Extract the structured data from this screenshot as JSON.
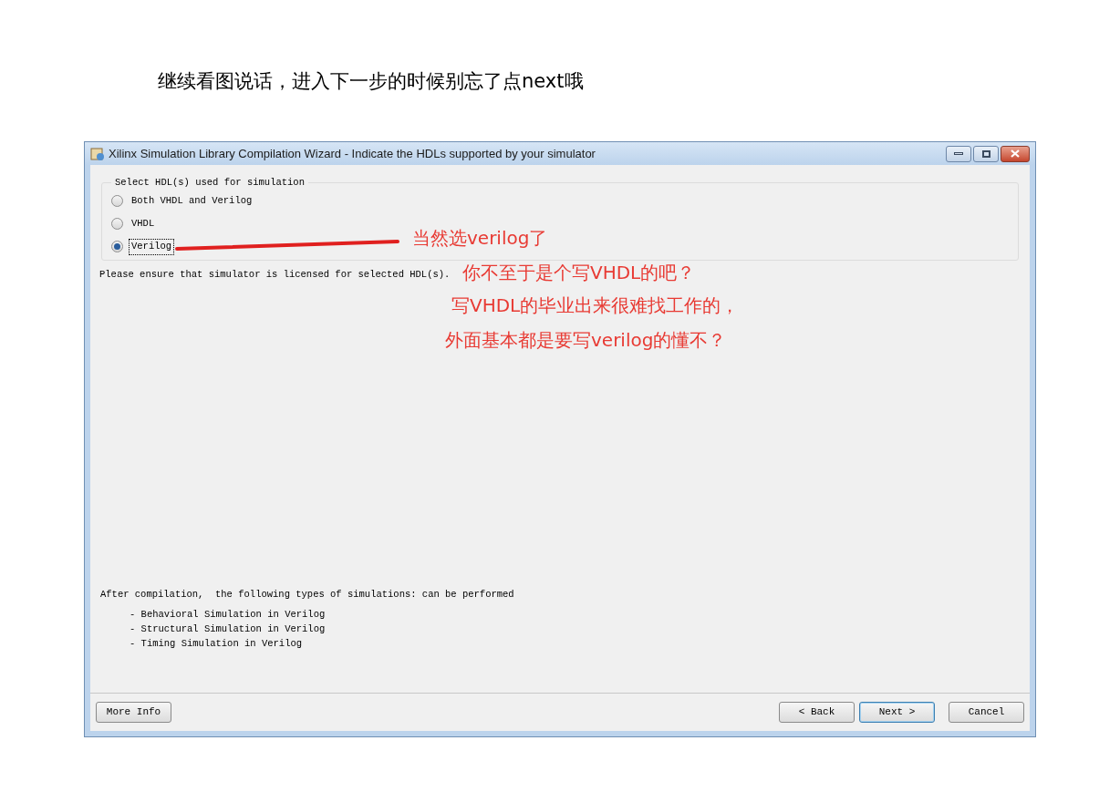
{
  "page_caption": "继续看图说话，进入下一步的时候别忘了点next哦",
  "window": {
    "title": "Xilinx Simulation Library Compilation Wizard - Indicate the HDLs supported by your simulator"
  },
  "hdl_group": {
    "legend": "Select HDL(s) used for simulation",
    "options": [
      {
        "label": "Both VHDL and Verilog",
        "selected": false
      },
      {
        "label": "VHDL",
        "selected": false
      },
      {
        "label": "Verilog",
        "selected": true
      }
    ]
  },
  "license_note": "Please ensure that simulator is licensed for selected HDL(s).",
  "summary": {
    "intro": "After compilation,  the following types of simulations: can be performed",
    "items": [
      "- Behavioral Simulation in Verilog",
      "- Structural Simulation in Verilog",
      "- Timing Simulation in Verilog"
    ]
  },
  "buttons": {
    "more_info": "More Info",
    "back": "< Back",
    "next": "Next >",
    "cancel": "Cancel"
  },
  "annotations": [
    "当然选verilog了",
    "你不至于是个写VHDL的吧？",
    "写VHDL的毕业出来很难找工作的，",
    "外面基本都是要写verilog的懂不？"
  ]
}
